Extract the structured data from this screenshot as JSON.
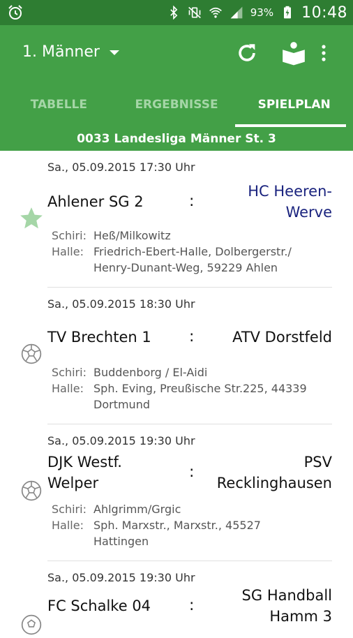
{
  "status": {
    "battery_percent": "93%",
    "time": "10:48"
  },
  "appbar": {
    "title": "1. Männer"
  },
  "tabs": [
    {
      "label": "TABELLE"
    },
    {
      "label": "ERGEBNISSE"
    },
    {
      "label": "SPIELPLAN",
      "active": true
    }
  ],
  "league": "0033 Landesliga Männer St. 3",
  "labels": {
    "referee": "Schiri:",
    "hall": "Halle:"
  },
  "matches": [
    {
      "date": "Sa., 05.09.2015 17:30 Uhr",
      "home_line1": "Ahlener SG 2",
      "home_line2": "",
      "separator": ":",
      "away_line1": "HC Heeren-",
      "away_line2": "Werve",
      "referee": "Heß/Milkowitz",
      "hall_line1": "Friedrich-Ebert-Halle, Dolbergerstr./",
      "hall_line2": "Henry-Dunant-Weg, 59229 Ahlen",
      "icon": "star-icon",
      "favorite_color": "#1a237e"
    },
    {
      "date": "Sa., 05.09.2015 18:30 Uhr",
      "home_line1": "TV Brechten 1",
      "home_line2": "",
      "separator": ":",
      "away_line1": "ATV Dorstfeld",
      "away_line2": "",
      "referee": "Buddenborg / El-Aidi",
      "hall_line1": "Sph. Eving, Preußische Str.225, 44339",
      "hall_line2": "Dortmund",
      "icon": "handball-icon"
    },
    {
      "date": "Sa., 05.09.2015 19:30 Uhr",
      "home_line1": "DJK Westf.",
      "home_line2": "Welper",
      "separator": ":",
      "away_line1": "PSV",
      "away_line2": "Recklinghausen",
      "referee": "Ahlgrimm/Grgic",
      "hall_line1": "Sph. Marxstr., Marxstr., 45527",
      "hall_line2": "Hattingen",
      "icon": "handball-icon"
    },
    {
      "date": "Sa., 05.09.2015 19:30 Uhr",
      "home_line1": "FC Schalke 04",
      "home_line2": "",
      "separator": ":",
      "away_line1": "SG Handball",
      "away_line2": "Hamm 3",
      "icon": "handball-icon"
    }
  ],
  "colors": {
    "status_bar": "#2e7d32",
    "app_bar": "#43a047",
    "star": "#a5d6a7"
  }
}
